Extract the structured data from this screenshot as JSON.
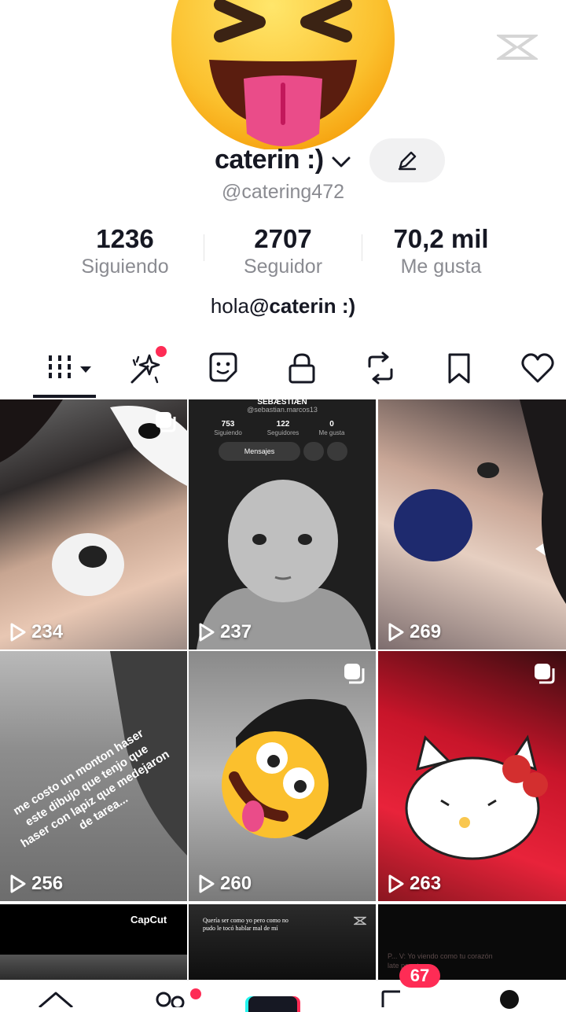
{
  "profile": {
    "display_name": "caterin :)",
    "handle": "@catering472",
    "bio_prefix": "hola",
    "bio_mention": "@caterin :)"
  },
  "stats": [
    {
      "value": "1236",
      "label": "Siguiendo"
    },
    {
      "value": "2707",
      "label": "Seguidor"
    },
    {
      "value": "70,2 mil",
      "label": "Me gusta"
    }
  ],
  "tabs": [
    {
      "icon": "grid-icon",
      "active": true
    },
    {
      "icon": "sparkle-icon",
      "active": false,
      "has_dot": true
    },
    {
      "icon": "sticker-icon",
      "active": false
    },
    {
      "icon": "lock-icon",
      "active": false
    },
    {
      "icon": "repost-icon",
      "active": false
    },
    {
      "icon": "bookmark-icon",
      "active": false
    },
    {
      "icon": "heart-icon",
      "active": false
    }
  ],
  "videos": [
    {
      "views": "234",
      "multi": true
    },
    {
      "views": "237",
      "multi": false,
      "inner": {
        "name": "SEBÆSTIÆN",
        "handle": "@sebastian.marcos13",
        "stats": [
          {
            "v": "753",
            "l": "Siguiendo"
          },
          {
            "v": "122",
            "l": "Seguidores"
          },
          {
            "v": "0",
            "l": "Me gusta"
          }
        ],
        "btn": "Mensajes"
      }
    },
    {
      "views": "269",
      "multi": false
    },
    {
      "views": "256",
      "multi": false,
      "caption": "me costo un monton haser este dibujo que tenjo que haser con lapiz que medejaron de tarea..."
    },
    {
      "views": "260",
      "multi": true
    },
    {
      "views": "263",
      "multi": true
    },
    {
      "views": "",
      "label": "CapCut"
    },
    {
      "views": "",
      "caption": "Quería ser como yo pero como no pudo le tocó hablar mal de mí"
    },
    {
      "views": "",
      "caption": "P... V: Yo viendo como tu corazón late por otra..."
    }
  ],
  "nav": {
    "inbox_badge": "67"
  },
  "colors": {
    "accent": "#fe2c55",
    "text": "#161823",
    "muted": "#8a8b91"
  }
}
